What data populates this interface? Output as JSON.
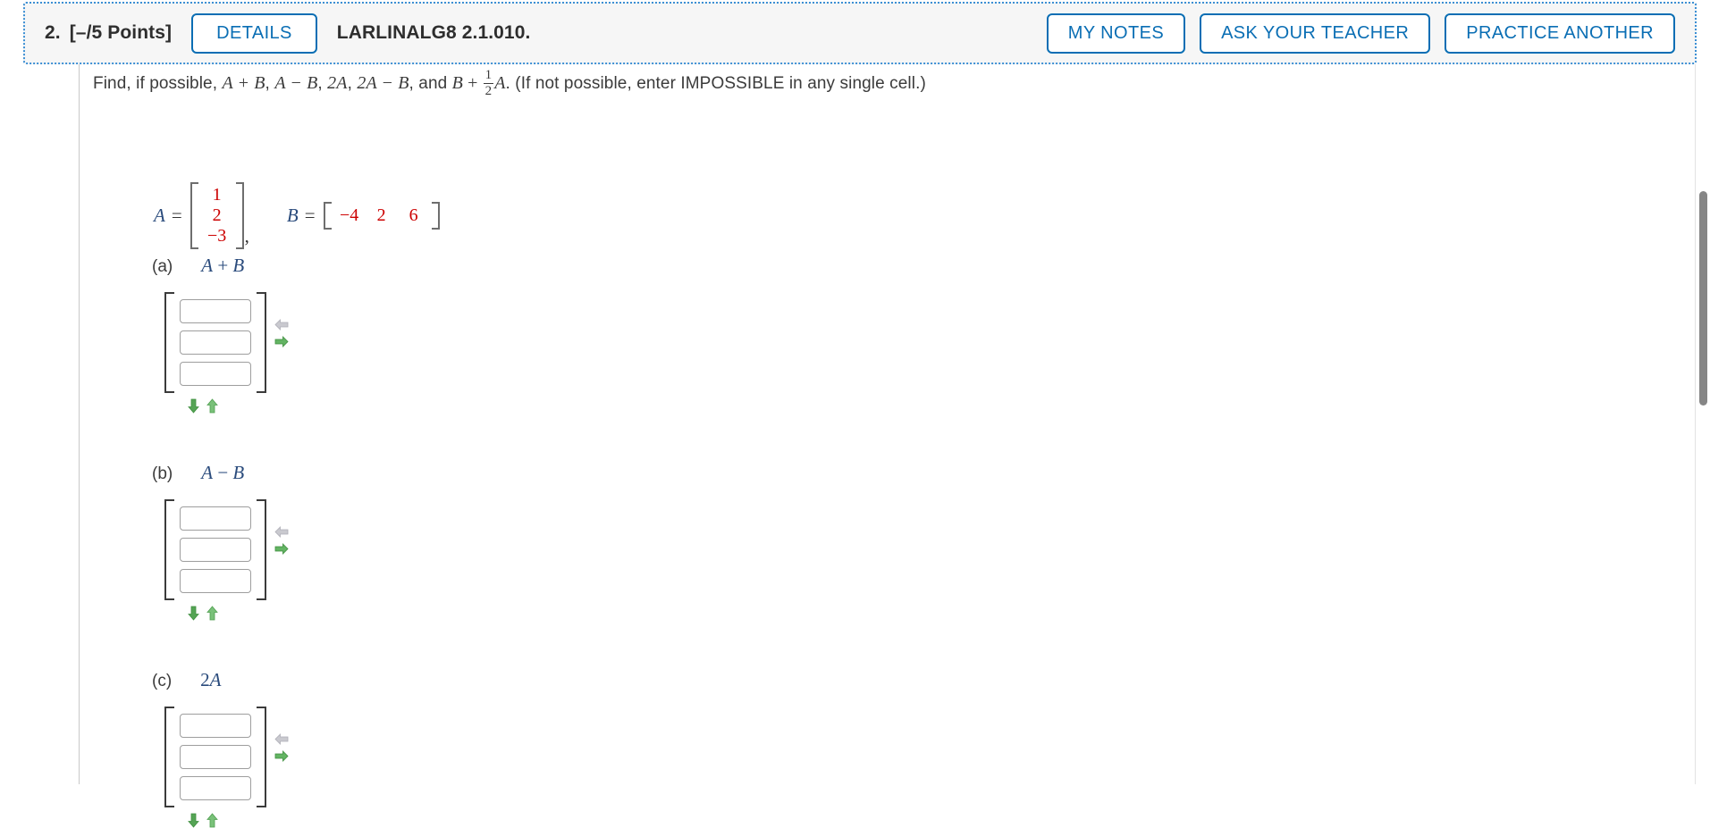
{
  "header": {
    "question_number": "2.",
    "points": "[–/5 Points]",
    "details_label": "DETAILS",
    "question_code": "LARLINALG8 2.1.010.",
    "my_notes_label": "MY NOTES",
    "ask_teacher_label": "ASK YOUR TEACHER",
    "practice_another_label": "PRACTICE ANOTHER",
    "accent_color": "#0a6eb4",
    "border_color": "#3c8fd4",
    "background_color": "#f6f6f6"
  },
  "prompt": {
    "lead": "Find, if possible, ",
    "expr1": "A + B",
    "sep1": ", ",
    "expr2": "A − B",
    "sep2": ", ",
    "expr3": "2A",
    "sep3": ", ",
    "expr4": "2A − B",
    "sep4": ", and ",
    "expr5_b": "B",
    "expr5_plus": " + ",
    "frac_num": "1",
    "frac_den": "2",
    "expr5_a": "A",
    "tail": ". (If not possible, enter IMPOSSIBLE in any single cell.)"
  },
  "given": {
    "matrix_a": {
      "label": "A",
      "equals": "=",
      "orientation": "column",
      "values": [
        "1",
        "2",
        "−3"
      ],
      "value_color": "#cc0000",
      "trailing_comma": ","
    },
    "matrix_b": {
      "label": "B",
      "equals": "=",
      "orientation": "row",
      "values": [
        "−4",
        "2",
        "6"
      ],
      "value_color": "#cc0000"
    }
  },
  "parts": [
    {
      "letter": "(a)",
      "expression_left": "A",
      "expression_op": " + ",
      "expression_right": "B",
      "cells": [
        "",
        "",
        ""
      ],
      "cell_placeholder": "",
      "left_arrow_state": "disabled",
      "right_arrow_state": "enabled",
      "down_arrow_state": "enabled",
      "up_arrow_state": "enabled"
    },
    {
      "letter": "(b)",
      "expression_left": "A",
      "expression_op": " − ",
      "expression_right": "B",
      "cells": [
        "",
        "",
        ""
      ],
      "cell_placeholder": "",
      "left_arrow_state": "disabled",
      "right_arrow_state": "enabled",
      "down_arrow_state": "enabled",
      "up_arrow_state": "enabled"
    },
    {
      "letter": "(c)",
      "expression_left": "2",
      "expression_op": "",
      "expression_right": "A",
      "cells": [
        "",
        "",
        ""
      ],
      "cell_placeholder": "",
      "left_arrow_state": "disabled",
      "right_arrow_state": "enabled",
      "down_arrow_state": "enabled",
      "up_arrow_state": "enabled"
    }
  ],
  "icons": {
    "left_arrow": "arrow-left-icon",
    "right_arrow": "arrow-right-icon",
    "down_arrow": "arrow-down-icon",
    "up_arrow": "arrow-up-icon"
  },
  "colors": {
    "arrow_green": "#5aab5a",
    "arrow_gray": "#bcbcc2",
    "rule_gray": "#c9c9c9",
    "scrollbar_thumb": "#868686"
  }
}
